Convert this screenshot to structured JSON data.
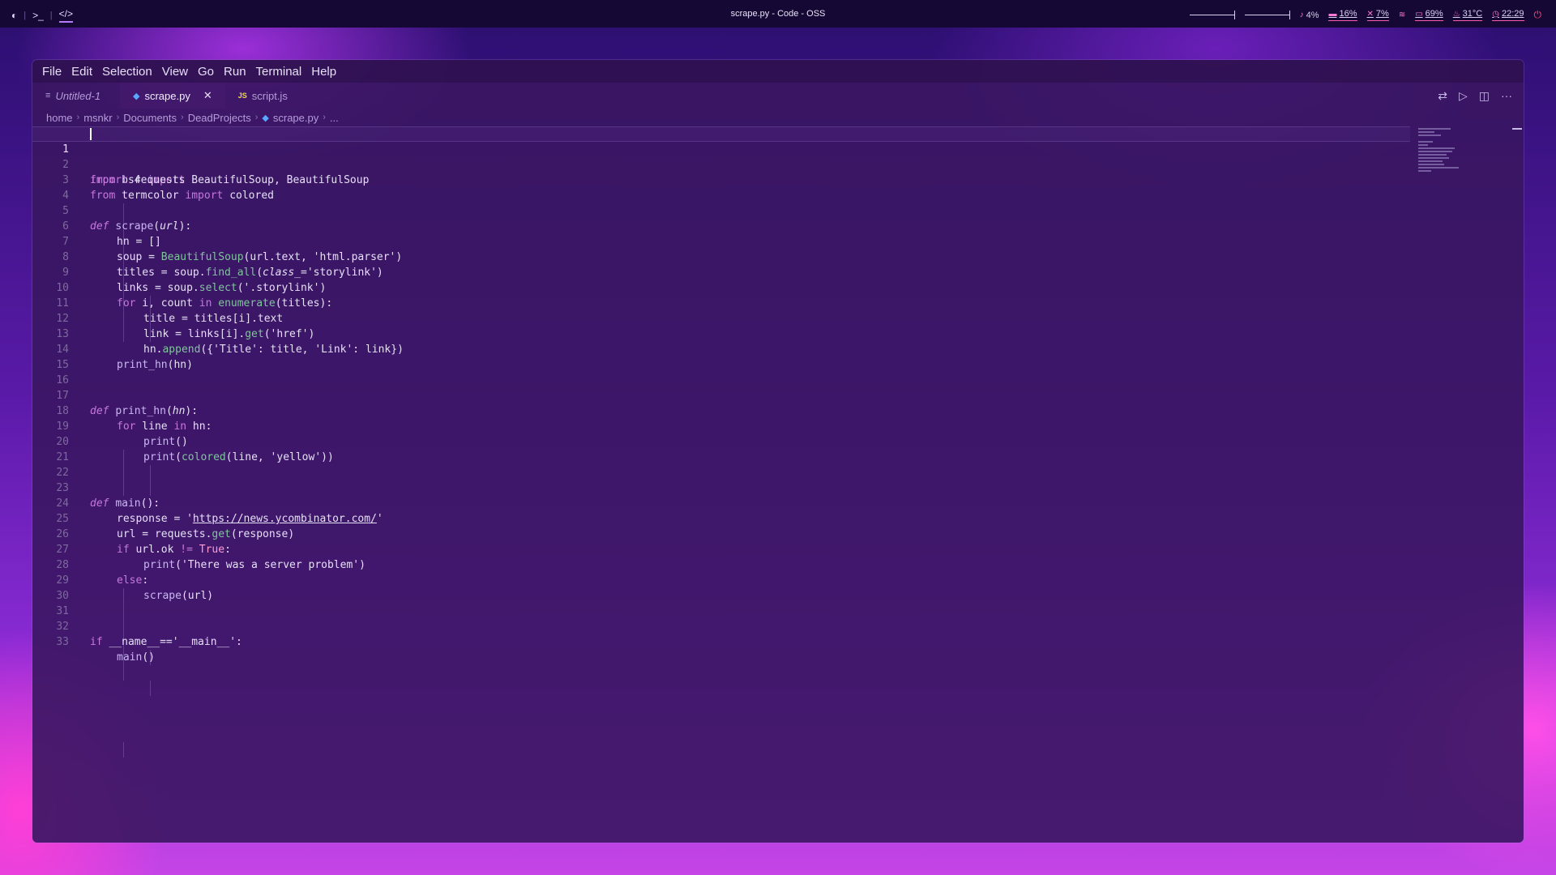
{
  "topbar": {
    "title": "scrape.py - Code - OSS",
    "left_glyphs": [
      "◐",
      "|",
      ">_",
      "|",
      "</>"
    ],
    "stats": [
      {
        "icon": "volume-icon",
        "glyph": "♪",
        "value": "4%"
      },
      {
        "icon": "cpu-icon",
        "glyph": "▬",
        "value": "16%"
      },
      {
        "icon": "memory-icon",
        "glyph": "✕",
        "value": "7%"
      },
      {
        "icon": "wifi-icon",
        "glyph": "≋",
        "value": ""
      },
      {
        "icon": "battery-icon",
        "glyph": "▭",
        "value": "69%"
      },
      {
        "icon": "temperature-icon",
        "glyph": "♨",
        "value": "31°C"
      },
      {
        "icon": "clock-icon",
        "glyph": "◷",
        "value": "22:29"
      }
    ]
  },
  "menubar": [
    "File",
    "Edit",
    "Selection",
    "View",
    "Go",
    "Run",
    "Terminal",
    "Help"
  ],
  "tabs": [
    {
      "label": "Untitled-1",
      "icon": "lines-icon",
      "glyph": "≡",
      "active": false
    },
    {
      "label": "scrape.py",
      "icon": "python-icon",
      "glyph": "◆",
      "active": true
    },
    {
      "label": "script.js",
      "icon": "javascript-icon",
      "glyph": "JS",
      "active": false
    }
  ],
  "breadcrumb": [
    "home",
    "msnkr",
    "Documents",
    "DeadProjects",
    "scrape.py",
    "..."
  ],
  "editor": {
    "current_line": 1,
    "lines": [
      "1",
      "2",
      "3",
      "4",
      "5",
      "6",
      "7",
      "8",
      "9",
      "10",
      "11",
      "12",
      "13",
      "14",
      "15",
      "16",
      "17",
      "18",
      "19",
      "20",
      "21",
      "22",
      "23",
      "24",
      "25",
      "26",
      "27",
      "28",
      "29",
      "30",
      "31",
      "32",
      "33"
    ],
    "tokens": {
      "l1": [
        "from",
        " bs4 ",
        "import",
        " BeautifulSoup, BeautifulSoup"
      ],
      "l2": [
        "import",
        " requests"
      ],
      "l3": [
        "from",
        " termcolor ",
        "import",
        " colored"
      ],
      "l5": [
        "def",
        " ",
        "scrape",
        "(",
        "url",
        "):"
      ],
      "l6": [
        "hn = []"
      ],
      "l7": [
        "soup = ",
        "BeautifulSoup",
        "(url.text, 'html.parser')"
      ],
      "l8": [
        "titles = soup.",
        "find_all",
        "(",
        "class_",
        "='storylink')"
      ],
      "l9": [
        "links = soup.",
        "select",
        "('.storylink')"
      ],
      "l10": [
        "for",
        " i, count ",
        "in",
        " ",
        "enumerate",
        "(titles):"
      ],
      "l11": [
        "title = titles[i].text"
      ],
      "l12": [
        "link = links[i].",
        "get",
        "('href')"
      ],
      "l13": [
        "hn.",
        "append",
        "({'Title': title, 'Link': link})"
      ],
      "l14": [
        "print_hn",
        "(hn)"
      ],
      "l17": [
        "def",
        " ",
        "print_hn",
        "(",
        "hn",
        "):"
      ],
      "l18": [
        "for",
        " line ",
        "in",
        " hn:"
      ],
      "l19": [
        "print",
        "()"
      ],
      "l20": [
        "print",
        "(",
        "colored",
        "(line, 'yellow'))"
      ],
      "l23": [
        "def",
        " ",
        "main",
        "():"
      ],
      "l24": [
        "response = '",
        "https://news.ycombinator.com/",
        "'"
      ],
      "l25": [
        "url = requests.",
        "get",
        "(response)"
      ],
      "l26": [
        "if",
        " url.ok ",
        "!=",
        " ",
        "True",
        ":"
      ],
      "l27": [
        "print",
        "('There was a server problem')"
      ],
      "l28": [
        "else",
        ":"
      ],
      "l29": [
        "scrape",
        "(url)"
      ],
      "l32": [
        "if",
        " __name__==",
        "'__main__'",
        ":"
      ],
      "l33": [
        "main",
        "()"
      ]
    }
  },
  "colors": {
    "keyword": "#c678dd",
    "method": "#7ec699",
    "function": "#c9b6f2",
    "text": "#e6e0f6",
    "line_number": "#7d6a9e",
    "window_bg": "#3a1662"
  }
}
